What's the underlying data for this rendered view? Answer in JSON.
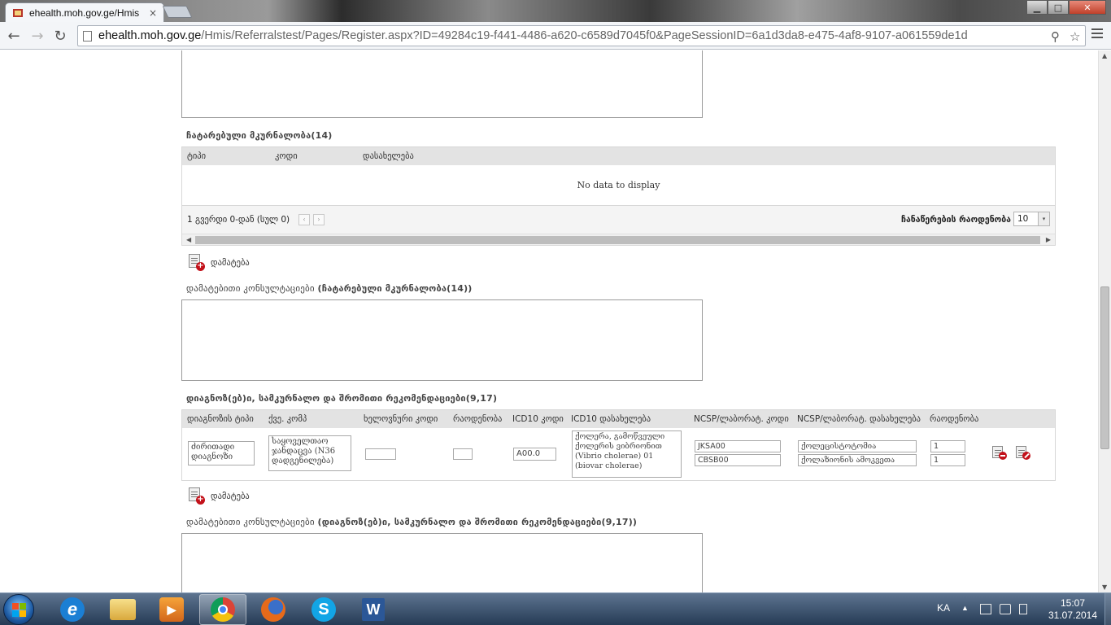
{
  "browser": {
    "tab_title": "ehealth.moh.gov.ge/Hmis",
    "tab_close": "×",
    "url_host": "ehealth.moh.gov.ge",
    "url_path": "/Hmis/Referralstest/Pages/Register.aspx?ID=49284c19-f441-4486-a620-c6589d7045f0&PageSessionID=6a1d3da8-e475-4af8-9107-a061559de1d",
    "back": "←",
    "forward": "→",
    "reload": "↻",
    "zoom": "⚲",
    "star": "☆",
    "min": "▁",
    "max": "□",
    "close": "✕"
  },
  "treatment": {
    "title": "ჩატარებული მკურნალობა(14)",
    "columns": [
      "ტიპი",
      "კოდი",
      "დასახელება"
    ],
    "empty_text": "No data to display",
    "pager_text": "1 გვერდი 0-დან (სულ 0)",
    "prev": "‹",
    "next": "›",
    "page_size_label": "ჩანაწერების რაოდენობა",
    "page_size_value": "10",
    "page_size_arrow": "▾",
    "scroll_left": "◀",
    "scroll_right": "▶"
  },
  "add_label": "დამატება",
  "consult1": {
    "label": "დამატებითი კონსულტაციები",
    "ref": "(ჩატარებული მკურნალობა(14))"
  },
  "diagnosis": {
    "title": "დიაგნოზ(ებ)ი, სამკურნალო და შრომითი რეკომენდაციები(9,17)",
    "columns": [
      "დიაგნოზის ტიპი",
      "ქვე. კომპ",
      "ხელოვნური კოდი",
      "რაოდენობა",
      "ICD10 კოდი",
      "ICD10 დასახელება",
      "NCSP/ლაბორატ. კოდი",
      "NCSP/ლაბორატ. დასახელება",
      "რაოდენობა"
    ],
    "row": {
      "type": "ძირითადი დიაგნოზი",
      "subcomp": "საყოველთაო ჯანდაცვა (N36 დადგენილება)",
      "artificial_code": "",
      "quantity": "",
      "icd10_code": "A00.0",
      "icd10_name": "ქოლერა, გამოწვეული ქოლერის ვიბრიონით (Vibrio cholerae) 01 (biovar cholerae)",
      "ncsp_codes": [
        "JKSA00",
        "CBSB00"
      ],
      "ncsp_names": [
        "ქოლეცისტოტომია",
        "ქოლაზიონის ამოკვეთა"
      ],
      "ncsp_qty": [
        "1",
        "1"
      ]
    }
  },
  "consult2": {
    "label": "დამატებითი კონსულტაციები",
    "ref": "(დიაგნოზ(ებ)ი, სამკურნალო და შრომითი რეკომენდაციები(9,17))"
  },
  "taskbar": {
    "lang": "KA",
    "tray_arrow": "▲",
    "time": "15:07",
    "date": "31.07.2014",
    "apps": [
      "internet-explorer",
      "file-explorer",
      "media-player",
      "chrome",
      "firefox",
      "skype",
      "word"
    ]
  }
}
